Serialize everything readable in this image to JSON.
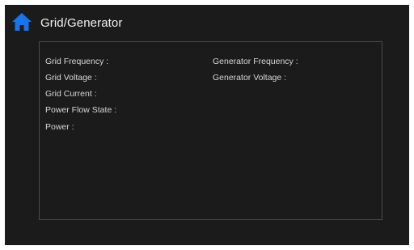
{
  "header": {
    "title": "Grid/Generator",
    "home_icon": "home-icon",
    "accent_color": "#1a73e8"
  },
  "panel": {
    "left_fields": [
      {
        "label": "Grid Frequency :"
      },
      {
        "label": "Grid Voltage :"
      },
      {
        "label": "Grid Current :"
      },
      {
        "label": "Power Flow State :"
      },
      {
        "label": "Power :"
      }
    ],
    "right_fields": [
      {
        "label": "Generator Frequency :"
      },
      {
        "label": "Generator Voltage :"
      }
    ]
  }
}
